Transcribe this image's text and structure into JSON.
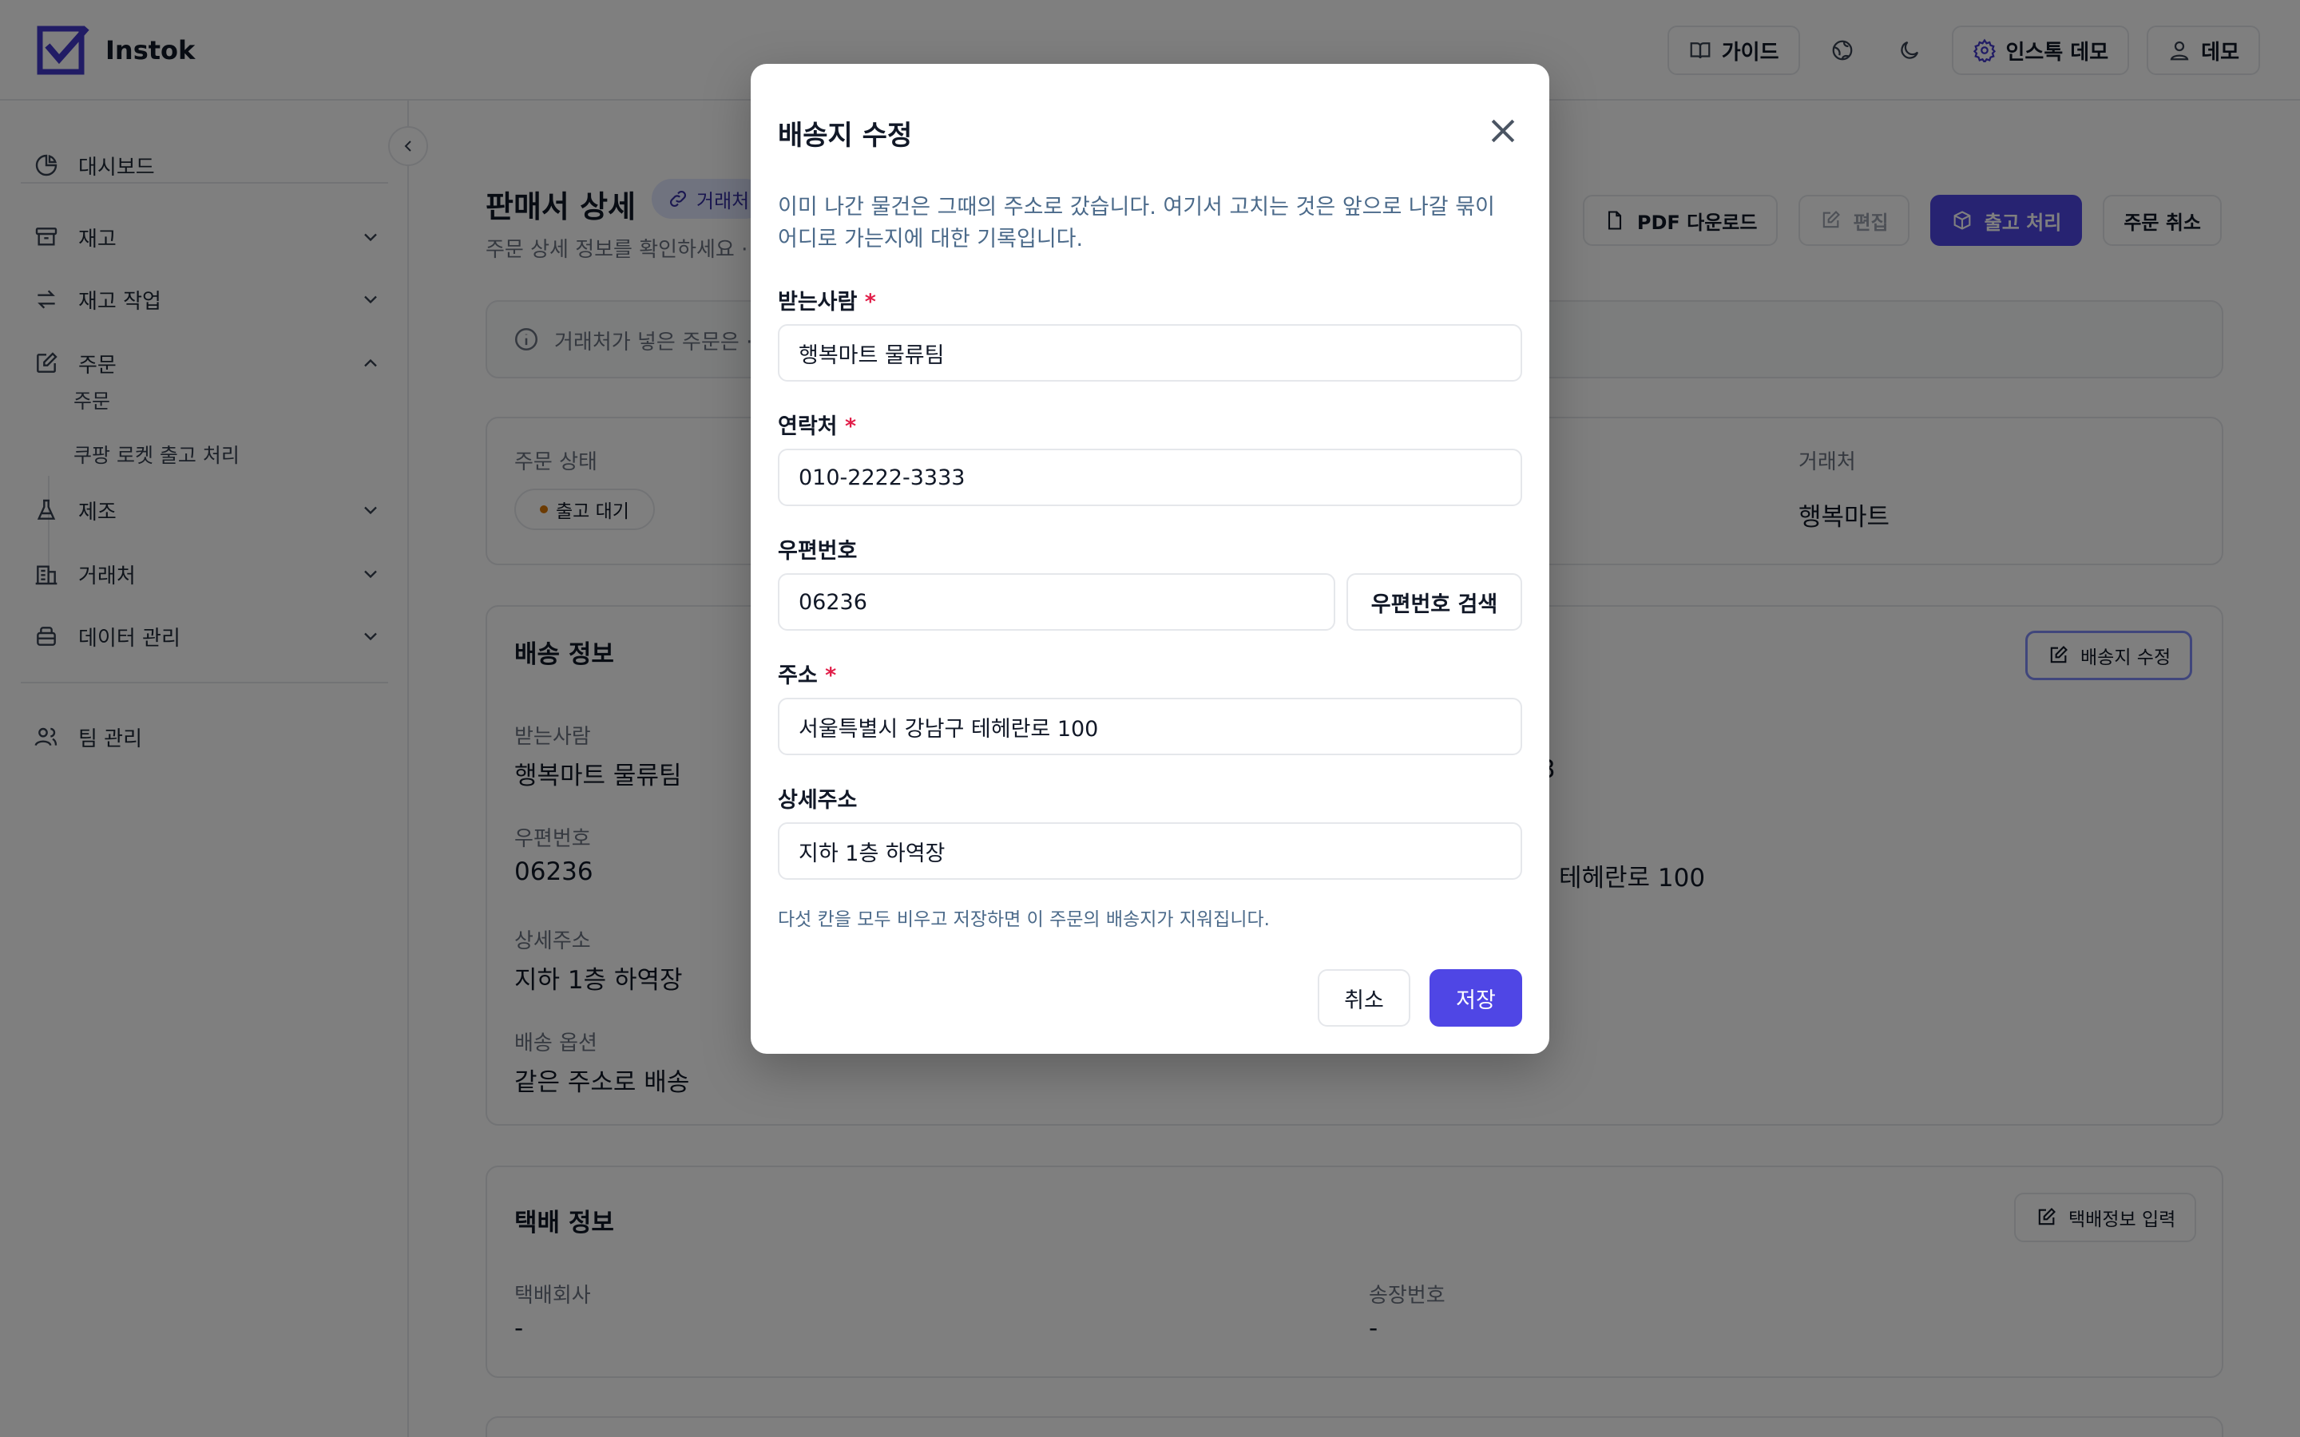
{
  "app": {
    "name": "Instok"
  },
  "header": {
    "guide_label": "가이드",
    "workspace_label": "인스톡 데모",
    "user_label": "데모"
  },
  "sidebar": {
    "items": [
      {
        "label": "대시보드",
        "icon": "chart-pie-icon"
      },
      {
        "label": "재고",
        "icon": "archive-icon"
      },
      {
        "label": "재고 작업",
        "icon": "arrows-exchange-icon"
      },
      {
        "label": "주문",
        "icon": "edit-note-icon"
      },
      {
        "label": "제조",
        "icon": "flask-icon"
      },
      {
        "label": "거래처",
        "icon": "building-icon"
      },
      {
        "label": "데이터 관리",
        "icon": "database-icon"
      },
      {
        "label": "팀 관리",
        "icon": "users-icon"
      }
    ],
    "sub_items": [
      "주문",
      "쿠팡 로켓 출고 처리"
    ]
  },
  "page": {
    "title": "판매서 상세",
    "link_chip": "거래처",
    "subtitle": "주문 상세 정보를 확인하세요 ·",
    "actions": {
      "pdf": "PDF 다운로드",
      "edit": "편집",
      "ship": "출고 처리",
      "cancel": "주문 취소"
    },
    "notice": "거래처가 넣은 주문은 ·"
  },
  "order_summary": {
    "status_label": "주문 상태",
    "status_value": "출고 대기",
    "partner_label": "거래처",
    "partner_value": "행복마트"
  },
  "shipping": {
    "title": "배송 정보",
    "edit_button": "배송지 수정",
    "recipient_label": "받는사람",
    "recipient": "행복마트 물류팀",
    "zip_label": "우편번호",
    "zip": "06236",
    "detail_label": "상세주소",
    "detail": "지하 1층 하역장",
    "option_label": "배송 옵션",
    "option": "같은 주소로 배송",
    "phone_fragment": "3",
    "address_fragment": "테헤란로 100"
  },
  "courier": {
    "title": "택배 정보",
    "input_button": "택배정보 입력",
    "company_label": "택배회사",
    "company": "-",
    "tracking_label": "송장번호",
    "tracking": "-"
  },
  "modal": {
    "title": "배송지 수정",
    "description": "이미 나간 물건은 그때의 주소로 갔습니다. 여기서 고치는 것은 앞으로 나갈 묶이 어디로 가는지에 대한 기록입니다.",
    "recipient_label": "받는사람",
    "recipient_value": "행복마트 물류팀",
    "phone_label": "연락처",
    "phone_value": "010-2222-3333",
    "zip_label": "우편번호",
    "zip_value": "06236",
    "zip_search": "우편번호 검색",
    "address_label": "주소",
    "address_value": "서울특별시 강남구 테헤란로 100",
    "detail_label": "상세주소",
    "detail_value": "지하 1층 하역장",
    "note": "다섯 칸을 모두 비우고 저장하면 이 주문의 배송지가 지워집니다.",
    "cancel": "취소",
    "save": "저장",
    "required_mark": "*"
  },
  "colors": {
    "primary": "#4f46e5",
    "required": "#e11d48",
    "overlay": "rgba(0,0,0,0.5)"
  }
}
